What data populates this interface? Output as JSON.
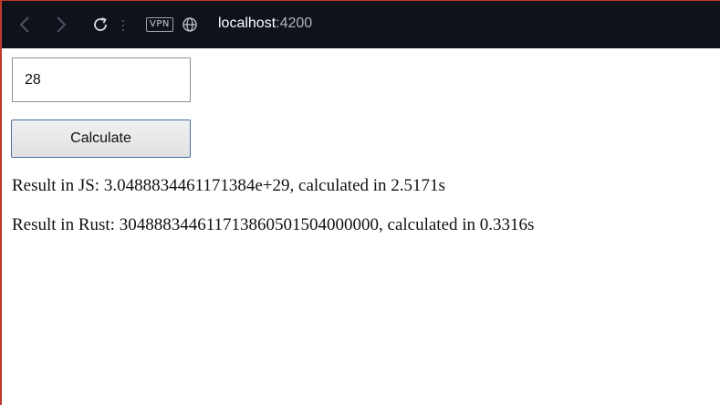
{
  "browser": {
    "url_host": "localhost",
    "url_port": ":4200",
    "vpn_label": "VPN",
    "icons": [
      "back-icon",
      "forward-icon",
      "reload-icon",
      "more-icon",
      "vpn-badge",
      "globe-icon"
    ]
  },
  "form": {
    "input_value": "28",
    "calculate_label": "Calculate"
  },
  "results": {
    "js": "Result in JS: 3.0488834461171384e+29, calculated in 2.5171s",
    "rust": "Result in Rust: 304888344611713860501504000000, calculated in 0.3316s"
  },
  "colors": {
    "toolbar_bg": "#0f121b",
    "button_border": "#4a6fa0"
  }
}
